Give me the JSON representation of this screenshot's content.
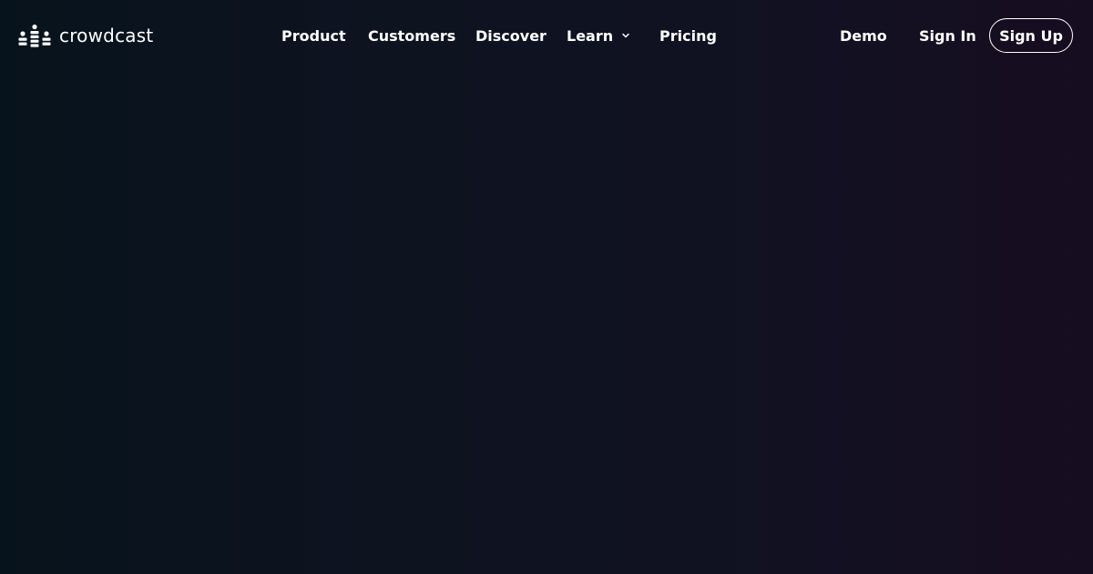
{
  "brand": {
    "name": "crowdcast",
    "logo_icon": "crowd-bars-icon"
  },
  "nav": {
    "items": [
      {
        "label": "Product"
      },
      {
        "label": "Customers"
      },
      {
        "label": "Discover"
      },
      {
        "label": "Learn",
        "icon": "chevron-down-icon"
      },
      {
        "label": "Pricing"
      }
    ]
  },
  "actions": {
    "demo_label": "Demo",
    "signin_label": "Sign In",
    "signup_label": "Sign Up"
  },
  "theme": {
    "background_left": "#07131c",
    "background_right": "#170d20",
    "text_color": "#ffffff"
  }
}
